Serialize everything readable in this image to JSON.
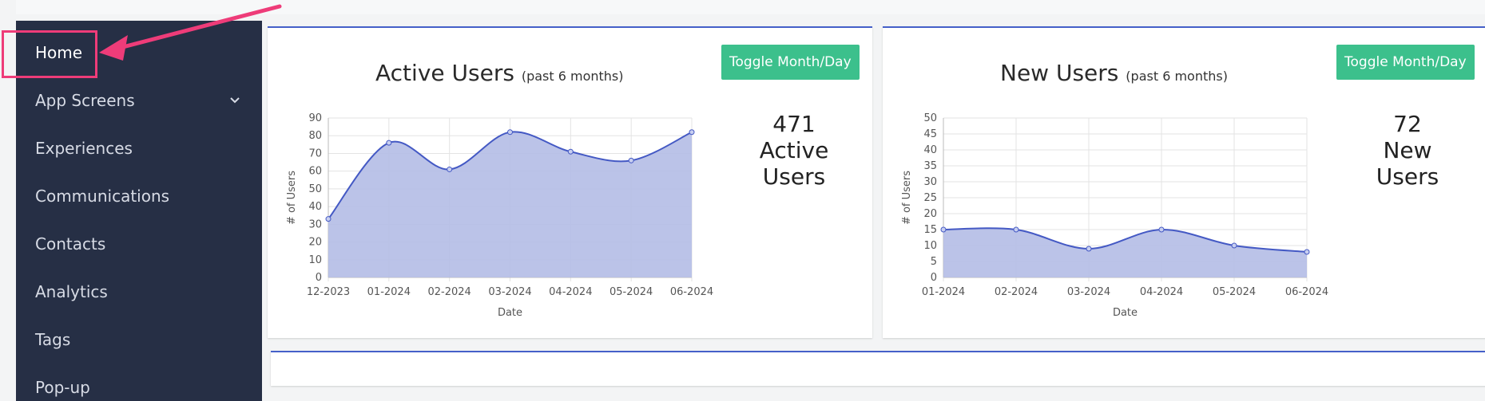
{
  "sidebar": {
    "items": [
      {
        "label": "Home",
        "active": true
      },
      {
        "label": "App Screens",
        "has_submenu": true
      },
      {
        "label": "Experiences"
      },
      {
        "label": "Communications"
      },
      {
        "label": "Contacts"
      },
      {
        "label": "Analytics"
      },
      {
        "label": "Tags"
      },
      {
        "label": "Pop-up"
      }
    ]
  },
  "cards": [
    {
      "title": "Active Users",
      "subtitle": "(past 6 months)",
      "toggle_label": "Toggle Month/Day",
      "stat_value": "471",
      "stat_line1": "Active",
      "stat_line2": "Users"
    },
    {
      "title": "New Users",
      "subtitle": "(past 6 months)",
      "toggle_label": "Toggle Month/Day",
      "stat_value": "72",
      "stat_line1": "New",
      "stat_line2": "Users"
    }
  ],
  "colors": {
    "sidebar_bg": "#262f45",
    "accent": "#4560c9",
    "button": "#3cc08c",
    "highlight": "#ee3c79",
    "area_fill": "#b4bde6",
    "line": "#4459c4"
  },
  "chart_data": [
    {
      "type": "area",
      "x": [
        "12-2023",
        "01-2024",
        "02-2024",
        "03-2024",
        "04-2024",
        "05-2024",
        "06-2024"
      ],
      "values": [
        33,
        76,
        61,
        82,
        71,
        66,
        82
      ],
      "xlabel": "Date",
      "ylabel": "# of Users",
      "ylim": [
        0,
        90
      ],
      "yticks": [
        0,
        10,
        20,
        30,
        40,
        50,
        60,
        70,
        80,
        90
      ],
      "grid": true
    },
    {
      "type": "area",
      "x": [
        "01-2024",
        "02-2024",
        "03-2024",
        "04-2024",
        "05-2024",
        "06-2024"
      ],
      "values": [
        15,
        15,
        9,
        15,
        10,
        8
      ],
      "xlabel": "Date",
      "ylabel": "# of Users",
      "ylim": [
        0,
        50
      ],
      "yticks": [
        0,
        5,
        10,
        15,
        20,
        25,
        30,
        35,
        40,
        45,
        50
      ],
      "grid": true
    }
  ]
}
